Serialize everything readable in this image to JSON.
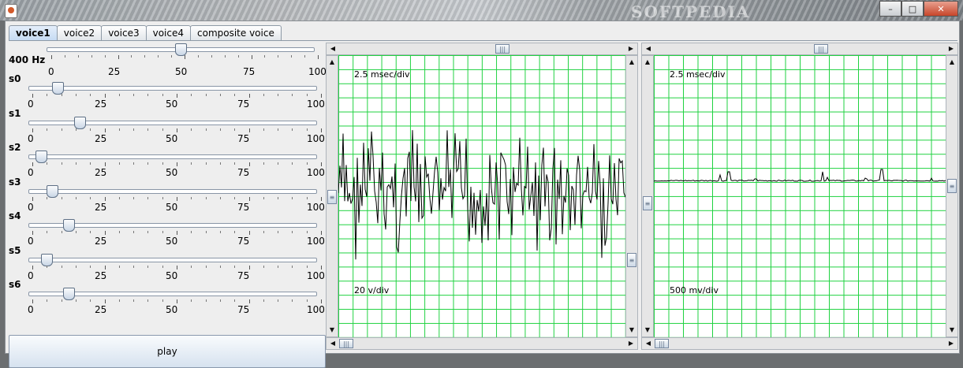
{
  "window": {
    "watermark": "SOFTPEDIA",
    "minimize": "–",
    "maximize": "□",
    "close": "✕",
    "icons": [
      "java-app-icon",
      "minimize-icon",
      "maximize-icon",
      "close-icon"
    ]
  },
  "tabs": [
    "voice1",
    "voice2",
    "voice3",
    "voice4",
    "composite voice"
  ],
  "active_tab": "voice1",
  "frequency_slider": {
    "label": "400 Hz",
    "value": 50,
    "ticks": [
      "0",
      "25",
      "50",
      "75",
      "100"
    ]
  },
  "harmonic_sliders": [
    {
      "label": "s0",
      "value": 9
    },
    {
      "label": "s1",
      "value": 17
    },
    {
      "label": "s2",
      "value": 3
    },
    {
      "label": "s3",
      "value": 7
    },
    {
      "label": "s4",
      "value": 13
    },
    {
      "label": "s5",
      "value": 5
    },
    {
      "label": "s6",
      "value": 13
    }
  ],
  "tick_labels": [
    "0",
    "25",
    "50",
    "75",
    "100"
  ],
  "play_label": "play",
  "scope_left": {
    "time_label": "2.5 msec/div",
    "amp_label": "20 v/div",
    "hscroll": 0.5,
    "vscroll": 0.5
  },
  "scope_right": {
    "time_label": "2.5 msec/div",
    "amp_label": "500 mv/div",
    "hscroll": 0.5,
    "vscroll": 0.5
  },
  "colors": {
    "grid": "#1fd240",
    "trace": "#000000",
    "accent": "#c6dbf3"
  }
}
